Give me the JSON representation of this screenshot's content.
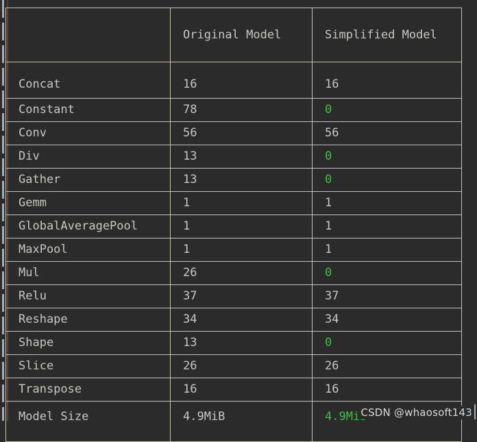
{
  "terminal": {
    "background_color": "#2b2b2b",
    "text_color": "#c8c8c0",
    "border_color": "#c9c3b5",
    "highlight_color": "#3fbf3f"
  },
  "table": {
    "columns": [
      "",
      "Original Model",
      "Simplified Model"
    ],
    "rows": [
      {
        "name": "Concat",
        "original": "16",
        "simplified": "16",
        "simplified_highlight": false
      },
      {
        "name": "Constant",
        "original": "78",
        "simplified": "0",
        "simplified_highlight": true
      },
      {
        "name": "Conv",
        "original": "56",
        "simplified": "56",
        "simplified_highlight": false
      },
      {
        "name": "Div",
        "original": "13",
        "simplified": "0",
        "simplified_highlight": true
      },
      {
        "name": "Gather",
        "original": "13",
        "simplified": "0",
        "simplified_highlight": true
      },
      {
        "name": "Gemm",
        "original": "1",
        "simplified": "1",
        "simplified_highlight": false
      },
      {
        "name": "GlobalAveragePool",
        "original": "1",
        "simplified": "1",
        "simplified_highlight": false
      },
      {
        "name": "MaxPool",
        "original": "1",
        "simplified": "1",
        "simplified_highlight": false
      },
      {
        "name": "Mul",
        "original": "26",
        "simplified": "0",
        "simplified_highlight": true
      },
      {
        "name": "Relu",
        "original": "37",
        "simplified": "37",
        "simplified_highlight": false
      },
      {
        "name": "Reshape",
        "original": "34",
        "simplified": "34",
        "simplified_highlight": false
      },
      {
        "name": "Shape",
        "original": "13",
        "simplified": "0",
        "simplified_highlight": true
      },
      {
        "name": "Slice",
        "original": "26",
        "simplified": "26",
        "simplified_highlight": false
      },
      {
        "name": "Transpose",
        "original": "16",
        "simplified": "16",
        "simplified_highlight": false
      },
      {
        "name": "Model Size",
        "original": "4.9MiB",
        "simplified": "4.9MiB",
        "simplified_highlight": true
      }
    ]
  },
  "watermark": {
    "text": "CSDN @whaosoft143"
  }
}
